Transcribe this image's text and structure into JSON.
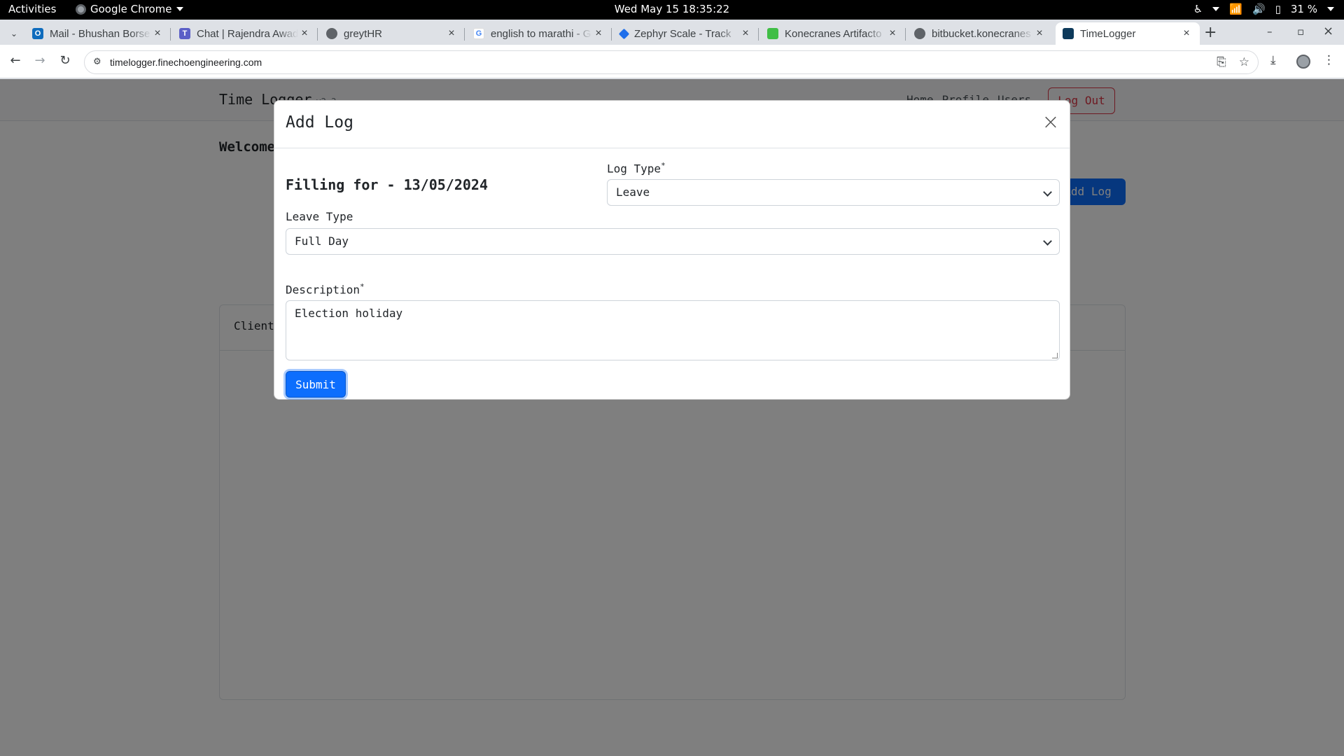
{
  "system": {
    "activities": "Activities",
    "app_name": "Google Chrome",
    "clock": "Wed May 15  18:35:22",
    "battery": "31 %"
  },
  "browser": {
    "tabs": [
      {
        "title": "Mail - Bhushan Borse",
        "favicon": "outlook-icon",
        "color": "#0f6cbd"
      },
      {
        "title": "Chat | Rajendra Awad",
        "favicon": "teams-icon",
        "color": "#5b5fc7"
      },
      {
        "title": "greytHR",
        "favicon": "globe-icon",
        "color": "#5f6368"
      },
      {
        "title": "english to marathi - G",
        "favicon": "google-icon",
        "color": "#4285f4"
      },
      {
        "title": "Zephyr Scale - Track",
        "favicon": "zephyr-icon",
        "color": "#1f6feb"
      },
      {
        "title": "Konecranes Artifacto",
        "favicon": "artifactory-icon",
        "color": "#40be46"
      },
      {
        "title": "bitbucket.konecranes",
        "favicon": "globe-icon",
        "color": "#5f6368"
      },
      {
        "title": "TimeLogger",
        "favicon": "timelogger-icon",
        "color": "#0e3a5b"
      }
    ],
    "url": "timelogger.finechoengineering.com"
  },
  "site": {
    "brand": "Time Logger",
    "version": "v2.3",
    "nav_links": [
      "Home",
      "Profile",
      "Users"
    ],
    "logout": "Log Out",
    "welcome": "Welcome",
    "add_log_button": "Add Log",
    "table_first_header": "Client"
  },
  "modal": {
    "title": "Add Log",
    "filling_for": "Filling for - 13/05/2024",
    "log_type_label": "Log Type",
    "log_type_value": "Leave",
    "leave_type_label": "Leave Type",
    "leave_type_value": "Full Day",
    "description_label": "Description",
    "description_value": "Election holiday",
    "required_mark": "*",
    "submit_label": "Submit"
  },
  "colors": {
    "primary": "#0d6efd",
    "danger": "#dc3545",
    "backdrop": "rgba(0,0,0,0.5)"
  }
}
